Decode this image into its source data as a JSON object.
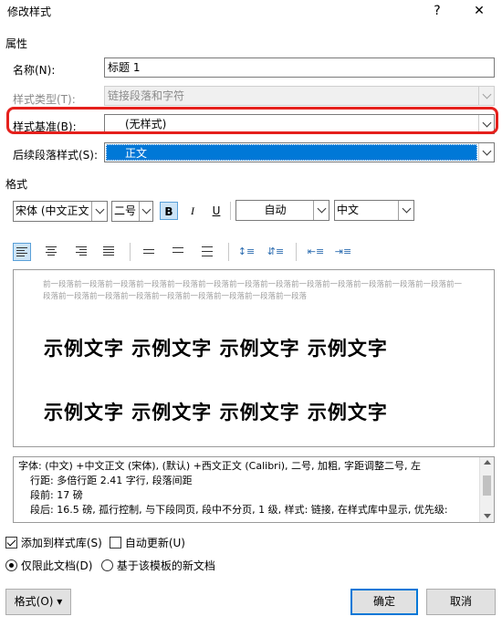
{
  "window": {
    "title": "修改样式",
    "help": "?",
    "close": "✕"
  },
  "properties": {
    "section": "属性",
    "name_label": "名称(N):",
    "name_value": "标题 1",
    "type_label": "样式类型(T):",
    "type_value": "链接段落和字符",
    "based_on_label": "样式基准(B):",
    "based_on_value": "(无样式)",
    "following_label": "后续段落样式(S):",
    "following_value": "正文"
  },
  "format": {
    "section": "格式",
    "font": "宋体 (中文正文",
    "size": "二号",
    "bold": "B",
    "italic": "I",
    "underline": "U",
    "color": "自动",
    "language": "中文"
  },
  "preview": {
    "prev_paragraph": "前一段落前一段落前一段落前一段落前一段落前一段落前一段落前一段落前一段落前一段落前一段落前一段落前一段落前一段落前一段落前一段落前一段落前一段落前一段落前一段落前一段落前一段落",
    "sample_line_1": "示例文字  示例文字  示例文字  示例文字",
    "sample_line_2": "示例文字  示例文字  示例文字  示例文字"
  },
  "description": {
    "line1": "字体: (中文) +中文正文 (宋体), (默认) +西文正文 (Calibri), 二号, 加粗, 字距调整二号, 左",
    "line2": "行距: 多倍行距 2.41 字行, 段落间距",
    "line3": "段前: 17 磅",
    "line4": "段后: 16.5 磅, 孤行控制, 与下段同页, 段中不分页, 1 级, 样式: 链接, 在样式库中显示, 优先级:"
  },
  "options": {
    "add_to_gallery": "添加到样式库(S)",
    "add_to_gallery_checked": true,
    "auto_update": "自动更新(U)",
    "auto_update_checked": false,
    "only_this_doc": "仅限此文档(D)",
    "new_docs_template": "基于该模板的新文档"
  },
  "buttons": {
    "format": "格式(O) ▾",
    "ok": "确定",
    "cancel": "取消"
  },
  "colors": {
    "highlight": "#e5201c",
    "selection": "#0078d7"
  }
}
